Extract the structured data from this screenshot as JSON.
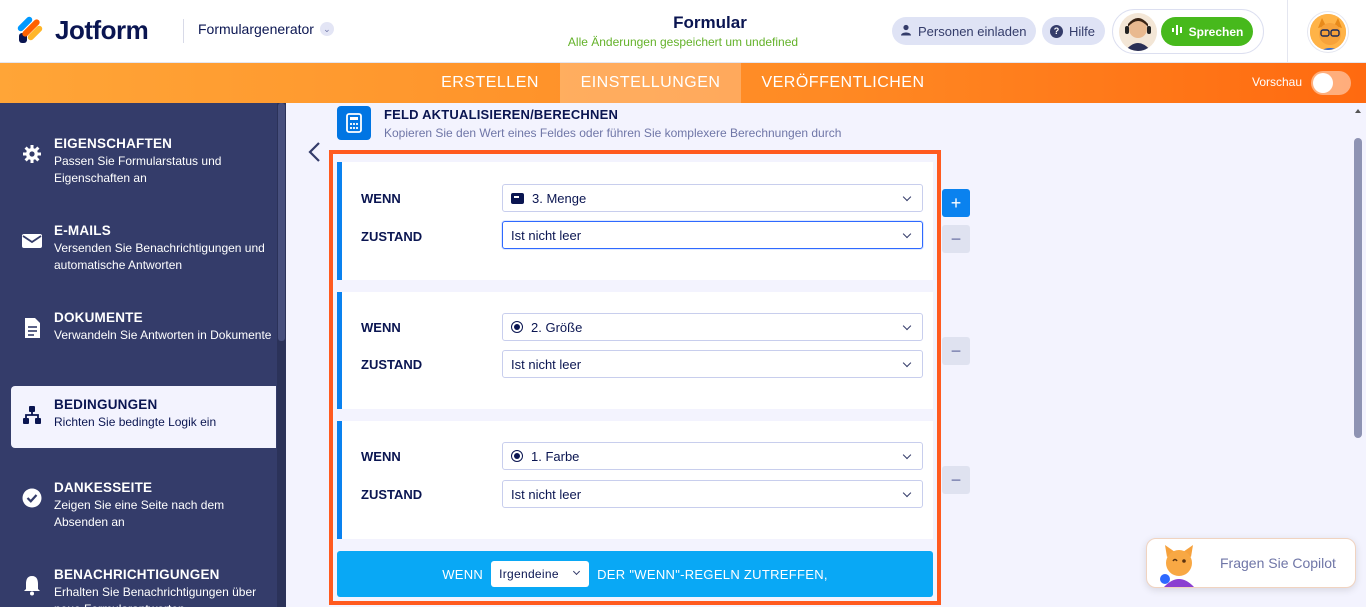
{
  "header": {
    "brand": "Jotform",
    "generator_label": "Formulargenerator",
    "form_title": "Formular",
    "save_status": "Alle Änderungen gespeichert um undefined",
    "invite_label": "Personen einladen",
    "help_label": "Hilfe",
    "speak_label": "Sprechen"
  },
  "nav": {
    "tabs": [
      "ERSTELLEN",
      "EINSTELLUNGEN",
      "VERÖFFENTLICHEN"
    ],
    "active_tab": "EINSTELLUNGEN",
    "preview_label": "Vorschau",
    "preview_enabled": false
  },
  "sidebar": {
    "items": [
      {
        "title": "EIGENSCHAFTEN",
        "desc": "Passen Sie Formularstatus und Eigenschaften an",
        "icon": "gear-icon"
      },
      {
        "title": "E-MAILS",
        "desc": "Versenden Sie Benachrichtigungen und automatische Antworten",
        "icon": "envelope-icon"
      },
      {
        "title": "DOKUMENTE",
        "desc": "Verwandeln Sie Antworten in Dokumente",
        "icon": "document-icon"
      },
      {
        "title": "BEDINGUNGEN",
        "desc": "Richten Sie bedingte Logik ein",
        "icon": "sitemap-icon",
        "active": true
      },
      {
        "title": "DANKESSEITE",
        "desc": "Zeigen Sie eine Seite nach dem Absenden an",
        "icon": "check-circle-icon"
      },
      {
        "title": "BENACHRICHTIGUNGEN",
        "desc": "Erhalten Sie Benachrichtigungen über neue Formularantworten",
        "icon": "bell-icon"
      }
    ]
  },
  "section": {
    "title": "FELD AKTUALISIEREN/BERECHNEN",
    "description": "Kopieren Sie den Wert eines Feldes oder führen Sie komplexere Berechnungen durch"
  },
  "conditions": [
    {
      "if_label": "WENN",
      "field": "3. Menge",
      "field_icon": "number-icon",
      "state_label": "ZUSTAND",
      "state": "Ist nicht leer"
    },
    {
      "if_label": "WENN",
      "field": "2. Größe",
      "field_icon": "radio-icon",
      "state_label": "ZUSTAND",
      "state": "Ist nicht leer"
    },
    {
      "if_label": "WENN",
      "field": "1. Farbe",
      "field_icon": "radio-icon",
      "state_label": "ZUSTAND",
      "state": "Ist nicht leer"
    }
  ],
  "rule_bar": {
    "prefix": "WENN",
    "match_value": "Irgendeine",
    "suffix": "DER \"WENN\"-REGELN ZUTREFFEN,"
  },
  "copilot": {
    "label": "Fragen Sie Copilot"
  },
  "colors": {
    "brand_orange": "#ff8a24",
    "sidebar_bg": "#343c6a",
    "accent_blue": "#0a82ef",
    "bar_blue": "#09a8f5",
    "highlight": "#ff5a1f",
    "speak_green": "#47b91c"
  }
}
